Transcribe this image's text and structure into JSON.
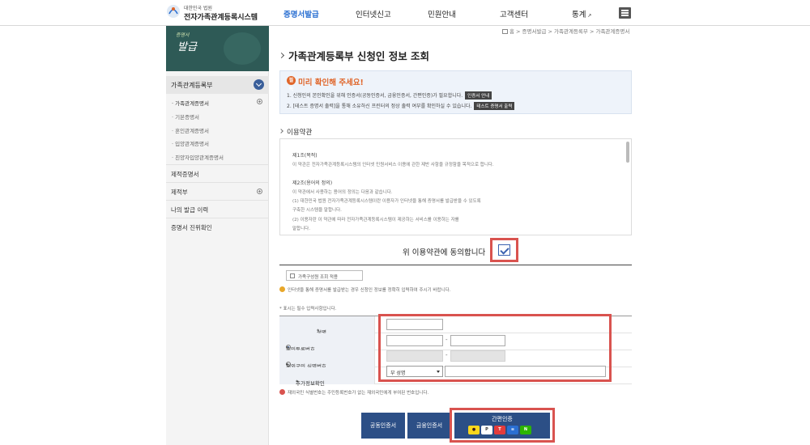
{
  "header": {
    "logo_small": "대한민국 법원",
    "logo_main": "전자가족관계등록시스템",
    "nav": [
      "증명서발급",
      "인터넷신고",
      "민원안내",
      "고객센터",
      "통계"
    ],
    "active_nav": "증명서발급"
  },
  "breadcrumb": "홈 > 증명서발급 > 가족관계등록부 > 가족관계증명서",
  "sidebar": {
    "banner_small": "증명서",
    "banner_title": "발급",
    "section": "가족관계등록부",
    "sub_items": [
      "· 가족관계증명서",
      "· 기본증명서",
      "· 혼인관계증명서",
      "· 입양관계증명서",
      "· 친양자입양관계증명서"
    ],
    "menus": [
      "제적증명서",
      "제적부",
      "나의 발급 이력",
      "증명서 진위확인"
    ]
  },
  "main": {
    "title": "가족관계등록부 신청인 정보 조회",
    "notice_icon": "필독",
    "notice_title": "미리 확인해 주세요!",
    "notice_line1": "1. 신청인의 본인확인을 위해 인증서(공동인증서, 금융인증서, 간편인증)가 필요합니다.",
    "notice_btn1": "인증서 안내",
    "notice_line2": "2. [테스트 증명서 출력]을 통해 소유하신 프린터의 정상 출력 여부를 확인하실 수 있습니다.",
    "notice_btn2": "테스트 증명서 출력",
    "terms_title": "이용약관",
    "terms": {
      "h1": "제1조(목적)",
      "p1": "이 약관은 전자가족관계등록시스템의 인터넷 민원서비스 이용에 관한 제반 사항을 규정함을 목적으로 합니다.",
      "h2": "제2조(용어의 정의)",
      "p2": "이 약관에서 사용하는 용어의 정의는 다음과 같습니다.",
      "p3": "(1) 대한민국 법원 전자가족관계등록시스템이란 이용자가 인터넷을 통해 증명서를 발급받을 수 있도록",
      "p4": "   구축한 시스템을 말합니다.",
      "p5": "(2) 이용자란 이 약관에 따라 전자가족관계등록시스템이 제공하는 서비스를 이용하는 자를",
      "p6": "   말합니다."
    },
    "agree_text": "위 이용약관에 동의합니다",
    "agree_checked": true,
    "toggle_label": "가족구성원 조회 적용",
    "note1": "인터넷을 통해 증명서를 발급받는 경우 신청인 정보를 정확히 입력하여 주시기 바랍니다.",
    "note2": "* 표시는 필수 입력사항입니다.",
    "form": {
      "name_label": "성명",
      "rrn_label": "주민등록번호",
      "foreign_label": "재외국민 식별번호",
      "addr_label": "추가정보확인",
      "addr_select": "부 성명"
    },
    "note3": "재외국민 식별번호는 주민등록번호가 없는 재외국민에게 부여된 번호입니다.",
    "buttons": {
      "cert1": "공동인증서",
      "cert2": "금융인증서",
      "simple": "간편인증"
    }
  },
  "colors": {
    "accent": "#2a6fd2",
    "button": "#2c4f86",
    "highlight": "#d9534f",
    "notice": "#e0662a"
  }
}
